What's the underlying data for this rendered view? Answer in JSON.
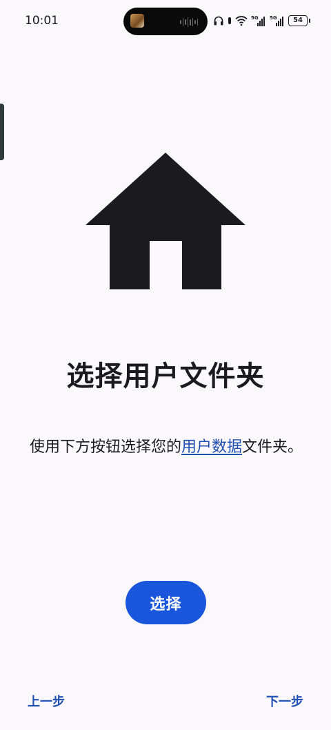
{
  "status_bar": {
    "time": "10:01",
    "battery": "54",
    "icons": [
      "notification-thumbnail-icon",
      "audio-wave-icon",
      "headphones-icon",
      "wifi-icon",
      "signal-5g-icon",
      "signal-5g-icon",
      "battery-icon"
    ],
    "network_labels": [
      "5G",
      "5G"
    ]
  },
  "main": {
    "illustration_icon": "home-icon",
    "title": "选择用户文件夹",
    "description_before": "使用下方按钮选择您的",
    "description_link": "用户数据",
    "description_after": "文件夹。"
  },
  "actions": {
    "select_label": "选择",
    "back_label": "上一步",
    "next_label": "下一步"
  },
  "colors": {
    "background": "#fbf8fc",
    "primary": "#1a56db",
    "link": "#1f4fb0",
    "text": "#1b1b1f"
  }
}
